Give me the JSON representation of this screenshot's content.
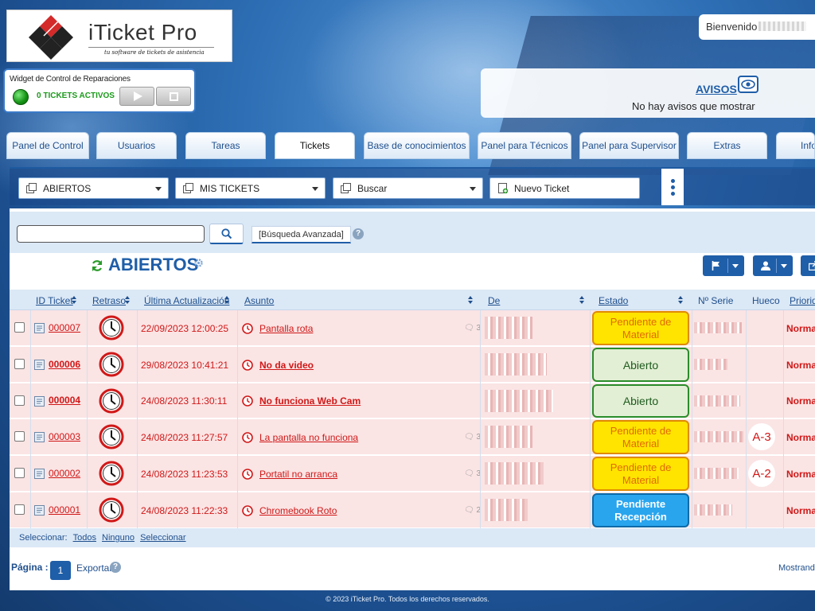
{
  "brand": {
    "title": "iTicket Pro",
    "subtitle": "tu software de tickets de asistencia"
  },
  "header": {
    "welcome_label": "Bienvenido"
  },
  "widget": {
    "title": "Widget de Control de Reparaciones",
    "active_tickets": "0 TICKETS ACTIVOS"
  },
  "notices": {
    "title": "AVISOS",
    "message": "No hay avisos que mostrar"
  },
  "nav": {
    "tabs": [
      {
        "label": "Panel de Control"
      },
      {
        "label": "Usuarios"
      },
      {
        "label": "Tareas"
      },
      {
        "label": "Tickets"
      },
      {
        "label": "Base de conocimientos"
      },
      {
        "label": "Panel para Técnicos"
      },
      {
        "label": "Panel para Supervisor"
      },
      {
        "label": "Extras"
      },
      {
        "label": "Info"
      }
    ],
    "active": "Tickets"
  },
  "toolbar": {
    "view_dropdown": "ABIERTOS",
    "mine_dropdown": "MIS TICKETS",
    "search_dropdown": "Buscar",
    "new_ticket": "Nuevo Ticket"
  },
  "search": {
    "input_value": "",
    "advanced_label": "[Búsqueda Avanzada]"
  },
  "list": {
    "heading": "ABIERTOS",
    "columns": {
      "id": "ID Ticket",
      "delay": "Retraso",
      "updated": "Última Actualización",
      "subject": "Asunto",
      "from": "De",
      "status": "Estado",
      "serial": "Nº Serie",
      "slot": "Hueco",
      "priority": "Prioridad"
    },
    "rows": [
      {
        "id": "000007",
        "updated": "22/09/2023 12:00:25",
        "subject": "Pantalla rota",
        "comments": "3",
        "status": "Pendiente de Material",
        "slot": "",
        "priority": "Normal"
      },
      {
        "id": "000006",
        "updated": "29/08/2023 10:41:21",
        "subject": "No da video",
        "comments": "",
        "status": "Abierto",
        "slot": "",
        "priority": "Normal"
      },
      {
        "id": "000004",
        "updated": "24/08/2023 11:30:11",
        "subject": "No funciona Web Cam",
        "comments": "",
        "status": "Abierto",
        "slot": "",
        "priority": "Normal"
      },
      {
        "id": "000003",
        "updated": "24/08/2023 11:27:57",
        "subject": "La pantalla no funciona",
        "comments": "3",
        "status": "Pendiente de Material",
        "slot": "A-3",
        "priority": "Normal"
      },
      {
        "id": "000002",
        "updated": "24/08/2023 11:23:53",
        "subject": "Portatil no arranca",
        "comments": "3",
        "status": "Pendiente de Material",
        "slot": "A-2",
        "priority": "Normal"
      },
      {
        "id": "000001",
        "updated": "24/08/2023 11:22:33",
        "subject": "Chromebook Roto",
        "comments": "2",
        "status": "Pendiente Recepción",
        "slot": "",
        "priority": "Normal"
      }
    ]
  },
  "selection": {
    "label": "Seleccionar:",
    "all": "Todos",
    "none": "Ninguno",
    "select": "Seleccionar"
  },
  "pager": {
    "label": "Página :",
    "current": "1",
    "export": "Exportar",
    "showing": "Mostrando"
  },
  "footer": {
    "copyright": "© 2023 iTicket Pro. Todos los derechos reservados."
  },
  "colors": {
    "brand_blue": "#1f5ea8",
    "row_bg": "#fbe4e4",
    "link_red": "#d01818",
    "status_pending": "#ffe400",
    "status_open": "#e2efd4",
    "status_reception": "#29a5ee"
  }
}
